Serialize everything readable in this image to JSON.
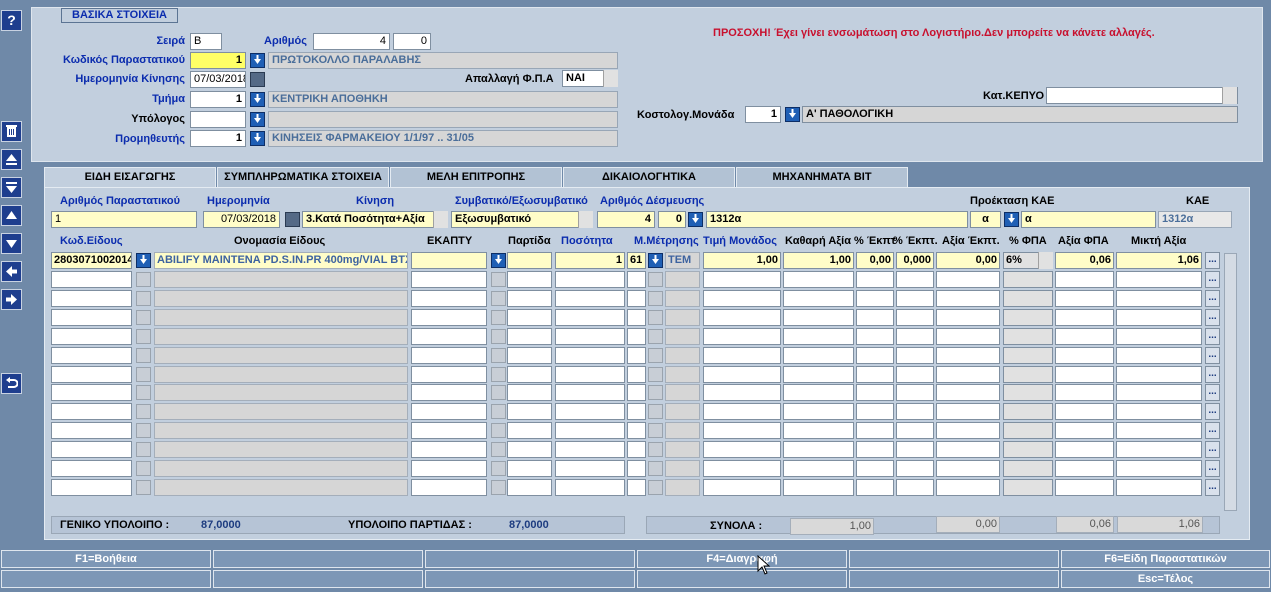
{
  "sidebar": {
    "help": "?"
  },
  "section_title": "ΒΑΣΙΚΑ ΣΤΟΙΧΕΙΑ",
  "warning": "ΠΡΟΣΟΧΗ! Έχει γίνει ενσωμάτωση στο Λογιστήριο.Δεν μπορείτε να κάνετε αλλαγές.",
  "form": {
    "seira_label": "Σειρά",
    "seira": "Β",
    "arithmos_label": "Αριθμός",
    "arithmos": "4",
    "arithmos2": "0",
    "kodikos_label": "Κωδικός Παραστατικού",
    "kodikos": "1",
    "kodikos_desc": "ΠΡΩΤΟΚΟΛΛΟ ΠΑΡΑΛΑΒΗΣ",
    "date_label": "Ημερομηνία Κίνησης",
    "date": "07/03/2018",
    "fpa_label": "Απαλλαγή Φ.Π.Α",
    "fpa": "ΝΑΙ",
    "tmima_label": "Τμήμα",
    "tmima": "1",
    "tmima_desc": "ΚΕΝΤΡΙΚΗ ΑΠΟΘΗΚΗ",
    "ypologos_label": "Υπόλογος",
    "promitheftis_label": "Προμηθευτής",
    "promitheftis": "1",
    "promitheftis_desc": "ΚΙΝΗΣΕΙΣ ΦΑΡΜΑΚΕΙΟΥ 1/1/97 .. 31/05",
    "kepyo_label": "Κατ.ΚΕΠΥΟ",
    "kostol_label": "Κοστολογ.Μονάδα",
    "kostol": "1",
    "kostol_desc": "Α' ΠΑΘΟΛΟΓΙΚΗ"
  },
  "tabs": [
    "ΕΙΔΗ ΕΙΣΑΓΩΓΗΣ",
    "ΣΥΜΠΛΗΡΩΜΑΤΙΚΑ ΣΤΟΙΧΕΙΑ",
    "ΜΕΛΗ ΕΠΙΤΡΟΠΗΣ",
    "ΔΙΚΑΙΟΛΟΓΗΤΙΚΑ",
    "ΜΗΧΑΝΗΜΑΤΑ ΒΙΤ"
  ],
  "tabform": {
    "arpar_label": "Αριθμός  Παραστατικού",
    "arpar": "1",
    "hm_label": "Ημερομηνία",
    "hm": "07/03/2018",
    "kinisi_label": "Κίνηση",
    "kinisi": "3.Κατά Ποσότητα+Αξία",
    "symv_label": "Συμβατικό/Εξωσυμβατικό",
    "symv": "Εξωσυμβατικό",
    "desm_label": "Αριθμός Δέσμευσης",
    "desm1": "4",
    "desm2": "0",
    "desm_code": "1312α",
    "proekt_label": "Προέκταση ΚΑΕ",
    "proekt": "α",
    "proekt2": "α",
    "kae_label": "ΚΑΕ",
    "kae": "1312α"
  },
  "columns": [
    "Κωδ.Είδους",
    "Ονομασία Είδους",
    "ΕΚΑΠΤΥ",
    "Παρτίδα",
    "Ποσότητα",
    "Μ.Μέτρησης",
    "Τιμή Μονάδος",
    "Καθαρή Αξία",
    "% Έκπτ",
    "% Έκπτ.",
    "Αξία Έκπτ.",
    "% ΦΠΑ",
    "Αξία  ΦΠΑ",
    "Μικτή Αξία"
  ],
  "row1": {
    "code": "2803071002014",
    "name": "ABILIFY MAINTENA PD.S.IN.PR 400mg/VIAL BTX",
    "qty": "1",
    "mm": "61",
    "mm_desc": "TEM",
    "price": "1,00",
    "net": "1,00",
    "disc1": "0,00",
    "disc2": "0,000",
    "disc_val": "0,00",
    "fpa": "6%",
    "fpa_val": "0,06",
    "gross": "1,06",
    "more": "..."
  },
  "totals": {
    "geniko_label": "ΓΕΝΙΚΟ ΥΠΟΛΟΙΠΟ :",
    "geniko": "87,0000",
    "partida_label": "ΥΠΟΛΟΙΠΟ ΠΑΡΤΙΔΑΣ :",
    "partida": "87,0000",
    "synola_label": "ΣΥΝΟΛΑ :",
    "t_net": "1,00",
    "t_disc": "0,00",
    "t_fpa": "0,06",
    "t_gross": "1,06"
  },
  "fkeys": [
    "F1=Βοήθεια",
    "",
    "",
    "F4=Διαγραφή",
    "",
    "F6=Είδη Παραστατικών",
    "",
    "",
    "",
    "",
    "",
    "Esc=Τέλος"
  ]
}
